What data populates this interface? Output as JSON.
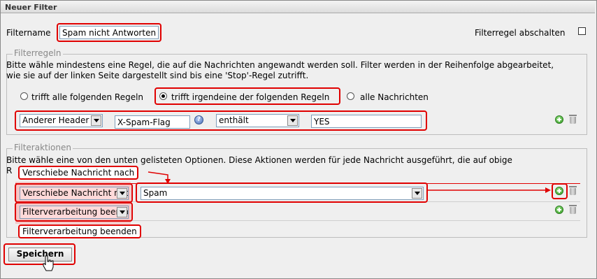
{
  "window": {
    "title": "Neuer Filter"
  },
  "filter": {
    "name_label": "Filtername",
    "name_value": "Spam nicht Antworten",
    "disable_label": "Filterregel abschalten"
  },
  "rules": {
    "legend": "Filterregeln",
    "description": "Bitte wähle mindestens eine Regel, die auf die Nachrichten angewandt werden soll. Filter werden in der Reihenfolge abgearbeitet, wie sie auf der linken Seite dargestellt sind bis eine 'Stop'-Regel zutrifft.",
    "options": [
      {
        "label": "trifft alle folgenden Regeln",
        "selected": false
      },
      {
        "label": "trifft irgendeine der folgenden Regeln",
        "selected": true
      },
      {
        "label": "alle Nachrichten",
        "selected": false
      }
    ],
    "rule_row": {
      "field": "Anderer Header",
      "header_name": "X-Spam-Flag",
      "operator": "enthält",
      "value": "YES"
    }
  },
  "actions": {
    "legend": "Filteraktionen",
    "description_line1": "Bitte wähle eine von den unten gelisteten Optionen. Diese Aktionen werden für jede Nachricht ausgeführt, die auf obige",
    "description_line2_start": "R",
    "action_rows": [
      {
        "action": "Verschiebe Nachricht nach",
        "target": "Spam"
      },
      {
        "action": "Filterverarbeitung beenden"
      }
    ],
    "callouts": {
      "move": "Verschiebe Nachricht nach",
      "stop": "Filterverarbeitung beenden"
    }
  },
  "buttons": {
    "save": "Speichern"
  },
  "colors": {
    "highlight": "#e00000",
    "background": "#efefef"
  }
}
